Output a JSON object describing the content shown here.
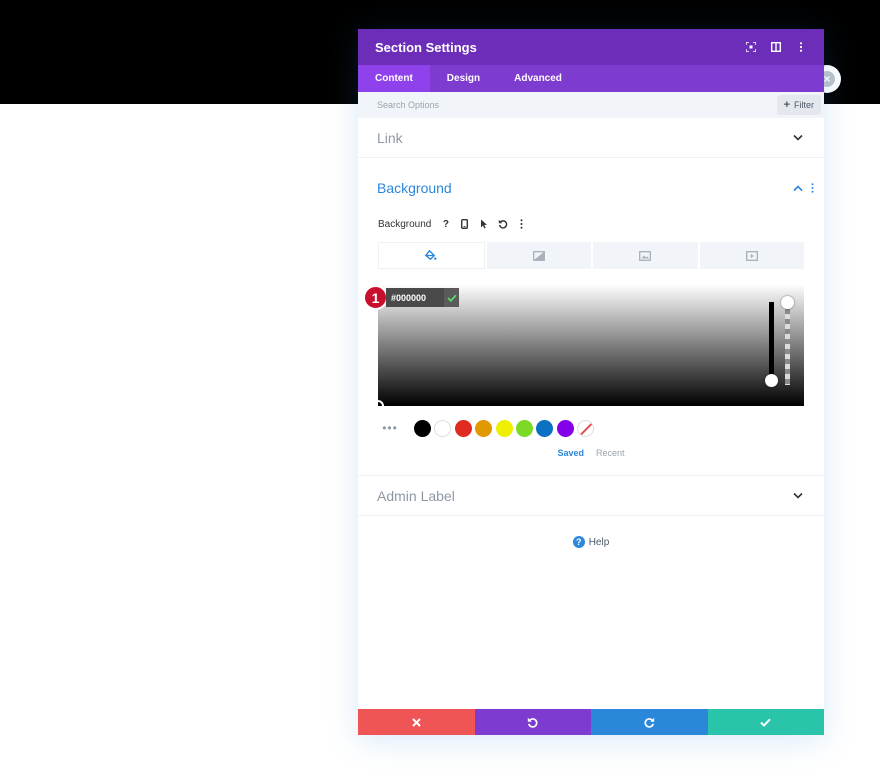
{
  "panel": {
    "title": "Section Settings",
    "tabs": [
      {
        "label": "Content",
        "active": true
      },
      {
        "label": "Design",
        "active": false
      },
      {
        "label": "Advanced",
        "active": false
      }
    ],
    "search": {
      "placeholder": "Search Options",
      "filter_label": "Filter"
    }
  },
  "sections": {
    "link": {
      "title": "Link",
      "expanded": false
    },
    "background": {
      "title": "Background",
      "expanded": true,
      "option_label": "Background",
      "bg_tabs": [
        {
          "icon": "paint-bucket-icon",
          "active": true
        },
        {
          "icon": "gradient-icon",
          "active": false
        },
        {
          "icon": "image-icon",
          "active": false
        },
        {
          "icon": "video-icon",
          "active": false
        }
      ],
      "color_picker": {
        "hex_value": "#000000",
        "badge_number": "1",
        "swatches": [
          "#000000",
          "#ffffff",
          "#e02b20",
          "#e09900",
          "#edf000",
          "#7cda24",
          "#0c71c3",
          "#8300e9"
        ],
        "saved_label": "Saved",
        "recent_label": "Recent"
      }
    },
    "admin_label": {
      "title": "Admin Label",
      "expanded": false
    }
  },
  "help": {
    "label": "Help"
  },
  "colors": {
    "header": "#6c2eb9",
    "tabs": "#7e3bd0",
    "accent": "#2b87da",
    "cancel": "#ef5555",
    "undo": "#7e3bd0",
    "redo": "#2b87da",
    "save": "#29c4a9"
  }
}
